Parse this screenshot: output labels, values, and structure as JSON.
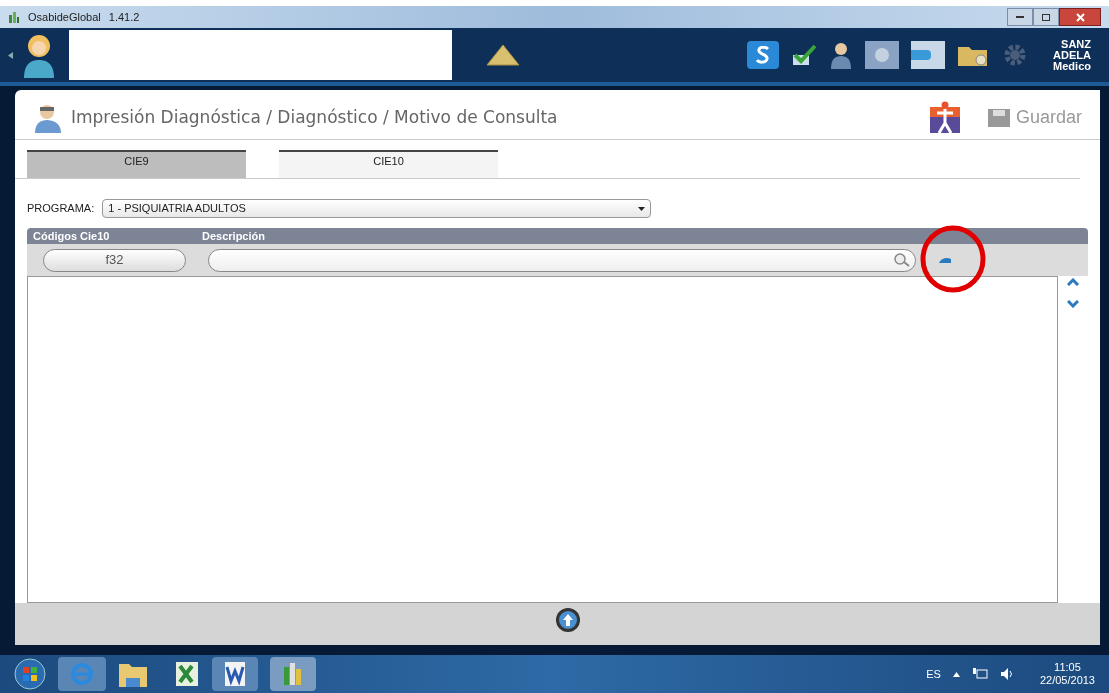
{
  "titlebar": {
    "app": "OsabideGlobal",
    "version": "1.41.2"
  },
  "header": {
    "surname": "SANZ",
    "name": "ADELA",
    "role": "Medico"
  },
  "panel": {
    "title": "Impresión Diagnóstica / Diagnóstico / Motivo de Consulta",
    "save": "Guardar"
  },
  "tabs": [
    {
      "label": "CIE9",
      "selected": false
    },
    {
      "label": "CIE10",
      "selected": true
    }
  ],
  "programa": {
    "label": "PROGRAMA:",
    "value": "1 - PSIQUIATRIA ADULTOS"
  },
  "columns": [
    "Códigos Cie10",
    "Descripción"
  ],
  "filters": {
    "code": "f32"
  },
  "taskbar": {
    "lang": "ES",
    "time": "11:05",
    "date": "22/05/2013"
  }
}
